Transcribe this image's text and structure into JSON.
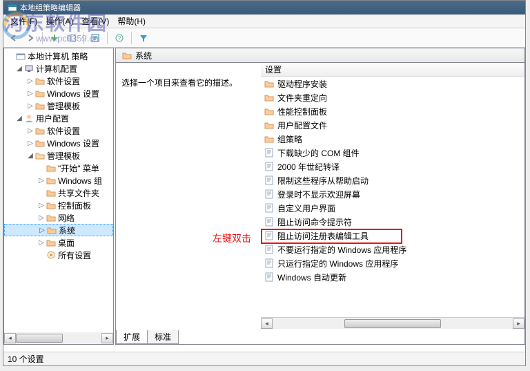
{
  "window_title": "本地组策略编辑器",
  "menu": {
    "file": "文件(F)",
    "action": "操作(A)",
    "view": "查看(V)",
    "help": "帮助(H)"
  },
  "tree": {
    "root": "本地计算机 策略",
    "comp_cfg": "计算机配置",
    "soft1": "软件设置",
    "win1": "Windows 设置",
    "admin1": "管理模板",
    "user_cfg": "用户配置",
    "soft2": "软件设置",
    "win2": "Windows 设置",
    "admin2": "管理模板",
    "start": "\"开始\" 菜单",
    "wincomp": "Windows 组",
    "shared": "共享文件夹",
    "ctrl": "控制面板",
    "net": "网络",
    "system": "系统",
    "desktop": "桌面",
    "allset": "所有设置"
  },
  "header_label": "系统",
  "desc_prompt": "选择一个项目来查看它的描述。",
  "col_header": "设置",
  "items": {
    "i0": "驱动程序安装",
    "i1": "文件夹重定向",
    "i2": "性能控制面板",
    "i3": "用户配置文件",
    "i4": "组策略",
    "i5": "下载缺少的 COM 组件",
    "i6": "2000 年世纪转译",
    "i7": "限制这些程序从帮助启动",
    "i8": "登录时不显示欢迎屏幕",
    "i9": "自定义用户界面",
    "i10": "阻止访问命令提示符",
    "i11": "阻止访问注册表编辑工具",
    "i12": "不要运行指定的 Windows 应用程序",
    "i13": "只运行指定的 Windows 应用程序",
    "i14": "Windows 自动更新"
  },
  "annotation": "左键双击",
  "tabs": {
    "ext": "扩展",
    "std": "标准"
  },
  "status": "10 个设置",
  "watermark": {
    "line1": "河东软件园",
    "line2": "www.pc0359.cn"
  }
}
